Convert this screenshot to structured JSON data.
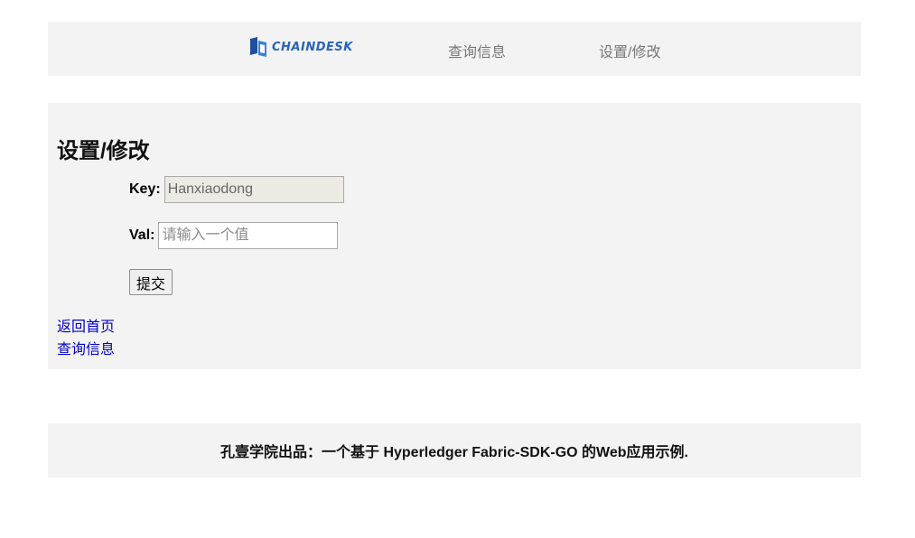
{
  "navbar": {
    "logo_text": "CHAINDESK",
    "links": [
      {
        "label": "查询信息"
      },
      {
        "label": "设置/修改"
      }
    ]
  },
  "main": {
    "title": "设置/修改",
    "key_label": "Key:",
    "key_value": "Hanxiaodong",
    "val_label": "Val:",
    "val_placeholder": "请输入一个值",
    "submit_label": "提交",
    "links": [
      {
        "label": "返回首页"
      },
      {
        "label": "查询信息"
      }
    ]
  },
  "footer": {
    "text": "孔壹学院出品：一个基于 Hyperledger Fabric-SDK-GO 的Web应用示例."
  },
  "colors": {
    "panel_bg": "#f3f3f3",
    "link": "#0000cc",
    "nav_text": "#777777",
    "logo_blue": "#2a64b8"
  }
}
